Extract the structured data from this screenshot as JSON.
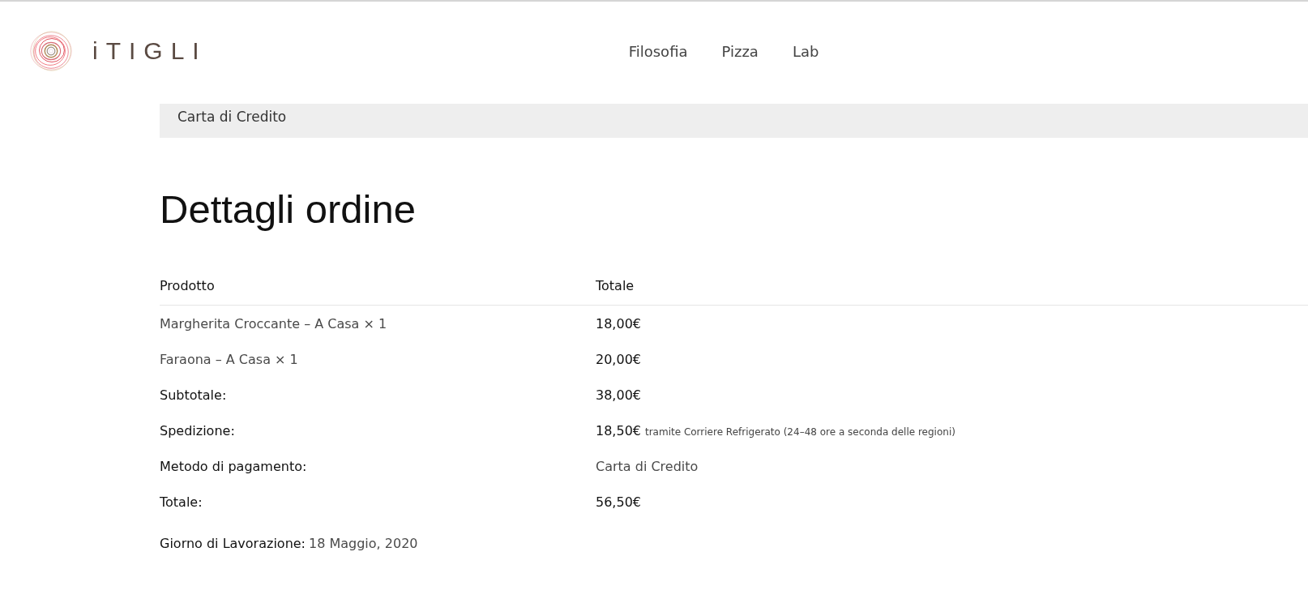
{
  "header": {
    "brand": "iTIGLI",
    "nav": [
      {
        "label": "Filosofia"
      },
      {
        "label": "Pizza"
      },
      {
        "label": "Lab"
      }
    ]
  },
  "payment_box": {
    "text": "Carta di Credito"
  },
  "order_details": {
    "title": "Dettagli ordine",
    "columns": [
      "Prodotto",
      "Totale"
    ],
    "rows": [
      {
        "kind": "item",
        "label": "Margherita Croccante – A Casa × 1",
        "value": "18,00€"
      },
      {
        "kind": "item",
        "label": "Faraona – A Casa × 1",
        "value": "20,00€"
      },
      {
        "kind": "summary",
        "label": "Subtotale:",
        "value": "38,00€"
      },
      {
        "kind": "summary",
        "label": "Spedizione:",
        "value": "18,50€",
        "note": "tramite Corriere Refrigerato (24–48 ore a seconda delle regioni)"
      },
      {
        "kind": "info",
        "label": "Metodo di pagamento:",
        "value": "Carta di Credito"
      },
      {
        "kind": "summary",
        "label": "Totale:",
        "value": "56,50€"
      }
    ],
    "work_day": {
      "label": "Giorno di Lavorazione:",
      "value": "18 Maggio, 2020"
    }
  }
}
